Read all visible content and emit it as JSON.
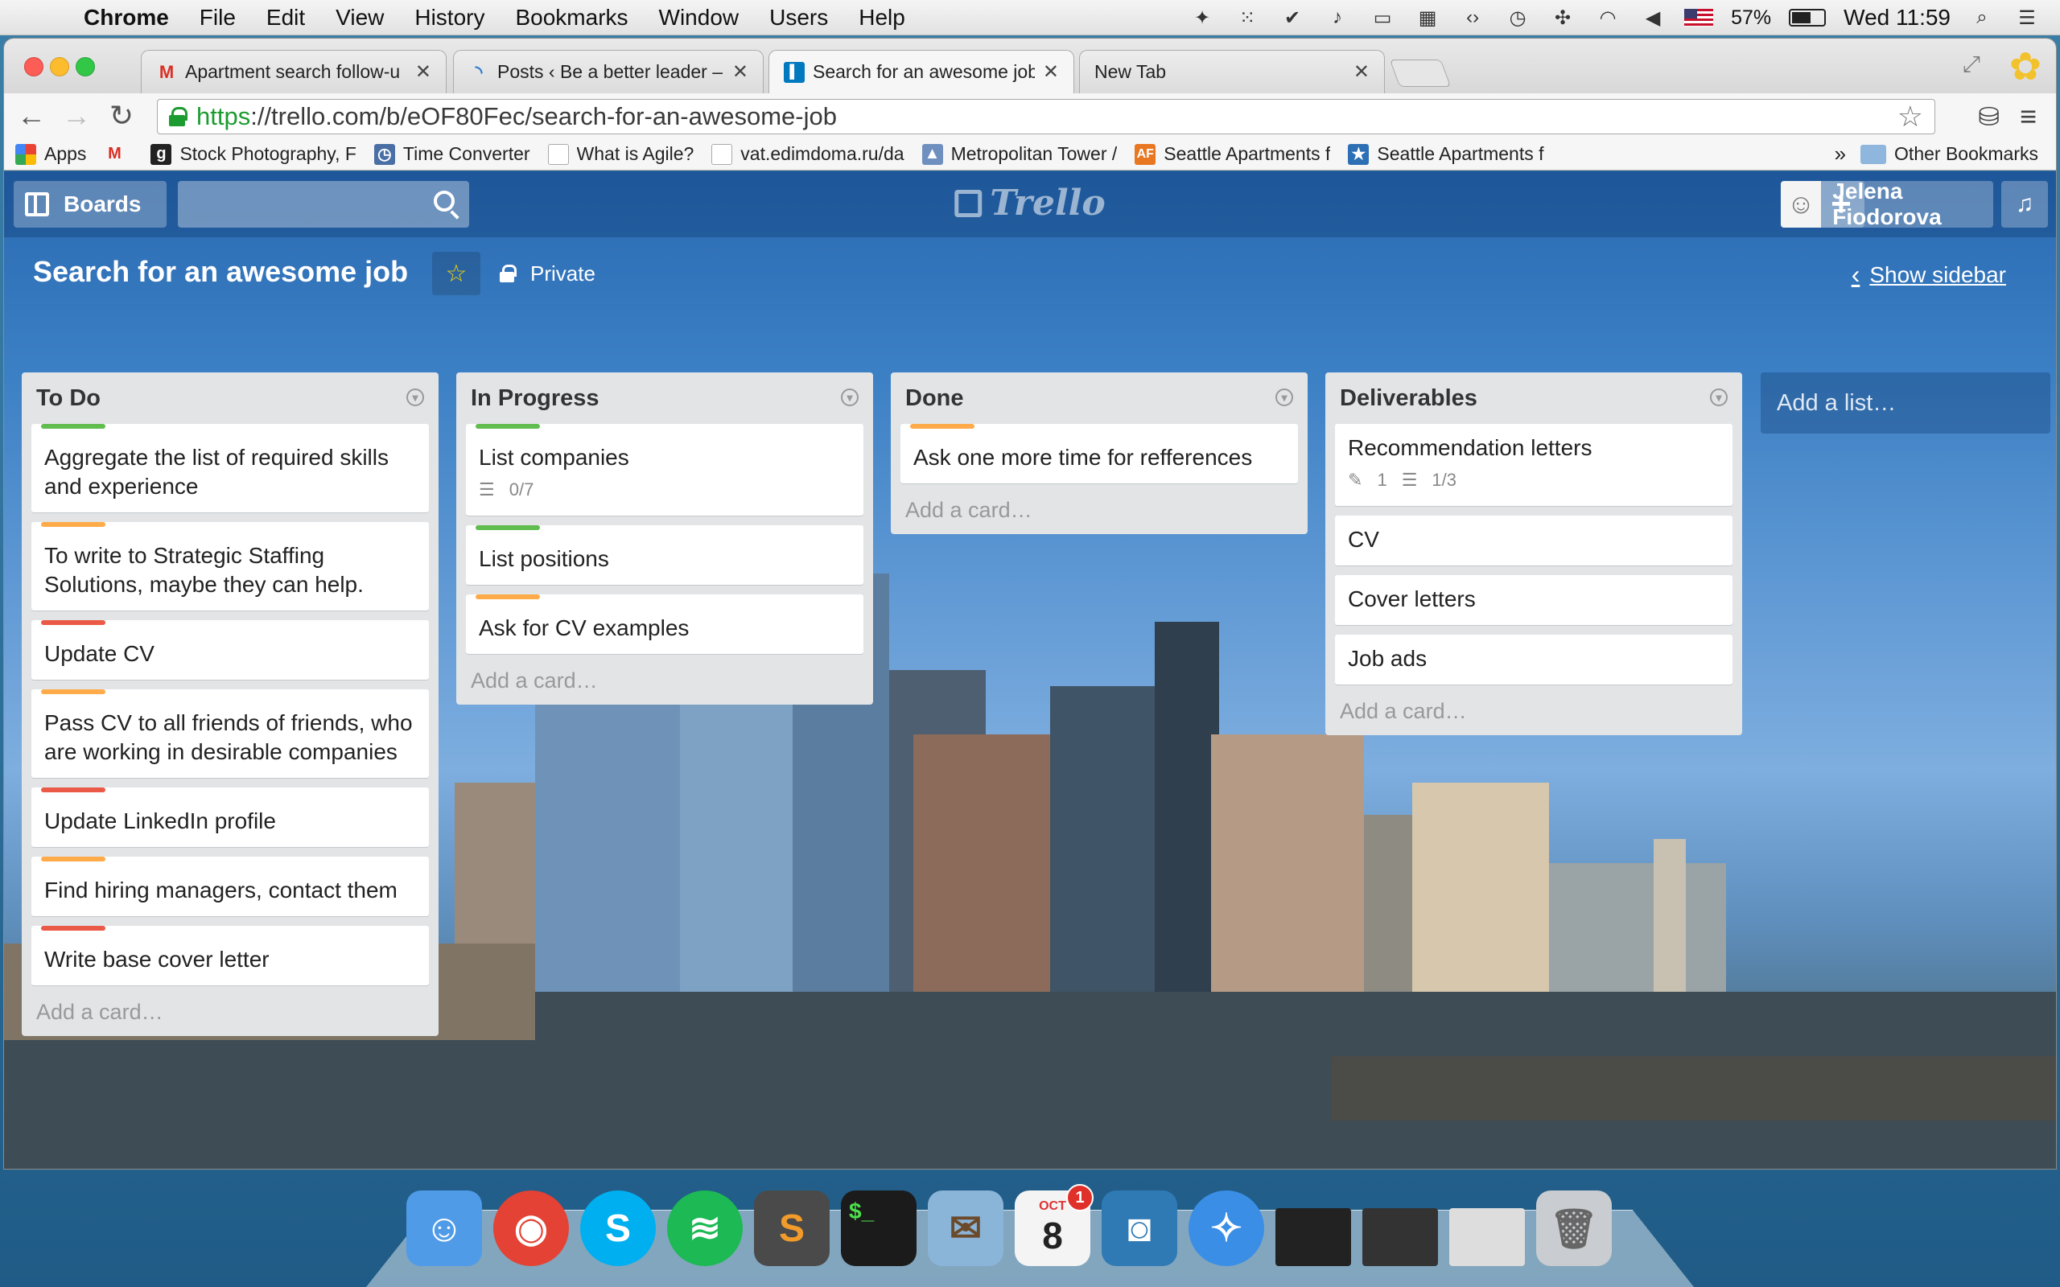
{
  "menubar": {
    "app": "Chrome",
    "items": [
      "File",
      "Edit",
      "View",
      "History",
      "Bookmarks",
      "Window",
      "Users",
      "Help"
    ],
    "battery": "57%",
    "clock": "Wed 11:59"
  },
  "tabs": [
    {
      "title": "Apartment search follow-u",
      "icon": "gmail-icon"
    },
    {
      "title": "Posts ‹ Be a better leader –",
      "icon": "loading-icon"
    },
    {
      "title": "Search for an awesome job",
      "icon": "trello-icon"
    },
    {
      "title": "New Tab",
      "icon": ""
    }
  ],
  "address": {
    "scheme": "https",
    "rest": "://trello.com/b/eOF80Fec/search-for-an-awesome-job"
  },
  "bookmarks": [
    {
      "label": "Apps"
    },
    {
      "label": ""
    },
    {
      "label": "Stock Photography, F"
    },
    {
      "label": "Time Converter"
    },
    {
      "label": "What is Agile?"
    },
    {
      "label": "vat.edimdoma.ru/da"
    },
    {
      "label": "Metropolitan Tower /"
    },
    {
      "label": "Seattle Apartments f"
    },
    {
      "label": "Seattle Apartments f"
    }
  ],
  "bookmarks_more": "»",
  "bookmarks_other": "Other Bookmarks",
  "header": {
    "boards": "Boards",
    "logo": "Trello",
    "add": "+",
    "user": "Jelena Fiodorova"
  },
  "board": {
    "title": "Search for an awesome job",
    "visibility": "Private",
    "sidebar": "Show sidebar"
  },
  "lists": [
    {
      "name": "To Do",
      "cards": [
        {
          "text": "Aggregate the list of required skills and experience",
          "label": "#61bd4f"
        },
        {
          "text": "To write to Strategic Staffing Solutions, maybe they can help.",
          "label": "#ffab4a"
        },
        {
          "text": "Update CV",
          "label": "#eb5a46"
        },
        {
          "text": "Pass CV to all friends of friends, who are working in desirable companies",
          "label": "#ffab4a"
        },
        {
          "text": "Update LinkedIn profile",
          "label": "#eb5a46"
        },
        {
          "text": "Find hiring managers, contact them",
          "label": "#ffab4a"
        },
        {
          "text": "Write base cover letter",
          "label": "#eb5a46"
        }
      ],
      "add_card": "Add a card…"
    },
    {
      "name": "In Progress",
      "cards": [
        {
          "text": "List companies",
          "label": "#61bd4f",
          "checklist": "0/7"
        },
        {
          "text": "List positions",
          "label": "#61bd4f"
        },
        {
          "text": "Ask for CV examples",
          "label": "#ffab4a"
        }
      ],
      "add_card": "Add a card…"
    },
    {
      "name": "Done",
      "cards": [
        {
          "text": "Ask one more time for refferences",
          "label": "#ffab4a"
        }
      ],
      "add_card": "Add a card…"
    },
    {
      "name": "Deliverables",
      "cards": [
        {
          "text": "Recommendation letters",
          "attachments": "1",
          "checklist": "1/3"
        },
        {
          "text": "CV"
        },
        {
          "text": "Cover letters"
        },
        {
          "text": "Job ads"
        }
      ],
      "add_card": "Add a card…"
    }
  ],
  "add_list": "Add a list…",
  "dock": [
    {
      "name": "finder-icon",
      "color": "#4f9be8"
    },
    {
      "name": "chrome-icon",
      "color": "#e34234"
    },
    {
      "name": "skype-icon",
      "color": "#00aff0"
    },
    {
      "name": "spotify-icon",
      "color": "#1db954"
    },
    {
      "name": "sublime-icon",
      "color": "#4a4a4a"
    },
    {
      "name": "terminal-icon",
      "color": "#1b1b1b"
    },
    {
      "name": "mail-icon",
      "color": "#8ab4d8"
    },
    {
      "name": "calendar-icon",
      "color": "#f4f4f4",
      "month": "OCT",
      "day": "8",
      "badge": "1"
    },
    {
      "name": "photo-booth-icon",
      "color": "#2f7ab5"
    },
    {
      "name": "safari-icon",
      "color": "#3a8ee6"
    },
    {
      "name": "window-thumb-1",
      "color": "#222"
    },
    {
      "name": "window-thumb-2",
      "color": "#333"
    },
    {
      "name": "window-thumb-3",
      "color": "#ddd"
    },
    {
      "name": "trash-icon",
      "color": "#c9ccd0"
    }
  ]
}
